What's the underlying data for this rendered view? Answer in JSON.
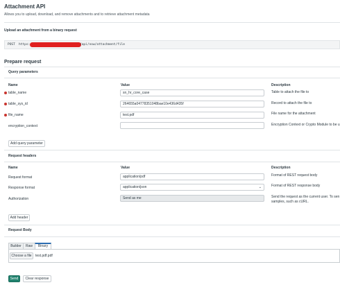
{
  "header": {
    "title": "Attachment API",
    "subtitle": "Allows you to upload, download, and remove attachments and to retrieve attachment metadata"
  },
  "endpoint": {
    "heading": "Upload an attachment from a binary request",
    "method": "POST",
    "url_prefix": "https://",
    "url_path": "/api/now/attachment/file",
    "redacted_color": "#e02020"
  },
  "prepare": {
    "title": "Prepare request",
    "query_params": {
      "heading": "Query parameters",
      "col_name": "Name",
      "col_value": "Value",
      "col_description": "Description",
      "rows": [
        {
          "name": "table_name",
          "value": "sn_hr_core_case",
          "description": "Table to attach the file to",
          "required": true
        },
        {
          "name": "table_sys_id",
          "value": "264655a04778351048bae10e436d435f",
          "description": "Record to attach the file to",
          "required": true
        },
        {
          "name": "file_name",
          "value": "test.pdf",
          "description": "File name for the attachment",
          "required": true
        },
        {
          "name": "encryption_context",
          "value": "",
          "description": "Encryption Context or Crypto Module to be u",
          "required": false
        }
      ],
      "add_button": "Add query parameter"
    },
    "request_headers": {
      "heading": "Request headers",
      "col_name": "Name",
      "col_value": "Value",
      "col_description": "Description",
      "rows": [
        {
          "name": "Request format",
          "value": "application/pdf",
          "description": "Format of REST request body"
        },
        {
          "name": "Response format",
          "value": "application/json",
          "description": "Format of REST response body"
        },
        {
          "name": "Authorization",
          "value": "Send as me",
          "description": "Send the request as the current user. To sen",
          "description2": "samples, such as cURL."
        }
      ],
      "add_button": "Add header"
    },
    "request_body": {
      "heading": "Request Body",
      "tabs": [
        "Builder",
        "Raw",
        "Binary"
      ],
      "active_tab": "Binary",
      "choose_file": "Choose a file",
      "file_name": "test.pdf.pdf"
    },
    "actions": {
      "send": "Send",
      "clear": "Clear response"
    }
  },
  "colors": {
    "required": "#c8342e",
    "primary": "#21826e",
    "tab_accent": "#2b6cb0"
  }
}
